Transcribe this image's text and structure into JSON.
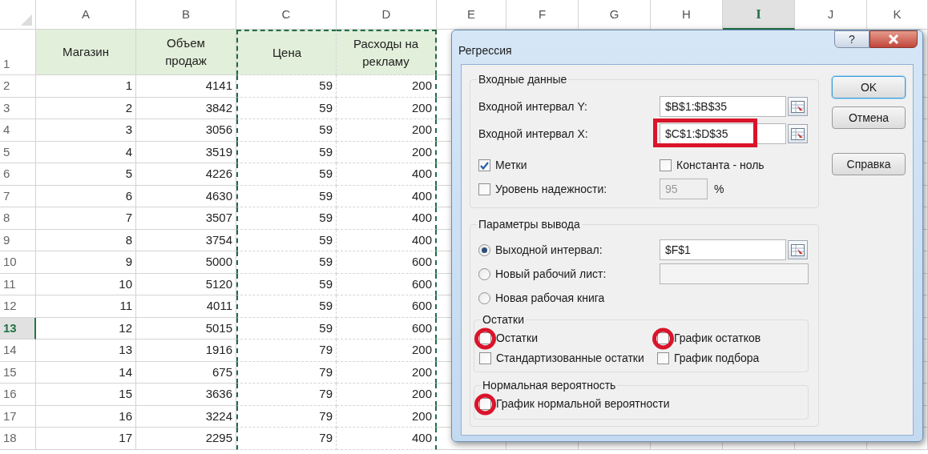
{
  "sheet": {
    "columns": [
      {
        "letter": "A",
        "selected": false,
        "marquee": false
      },
      {
        "letter": "B",
        "selected": false,
        "marquee": false
      },
      {
        "letter": "C",
        "selected": false,
        "marquee": true
      },
      {
        "letter": "D",
        "selected": false,
        "marquee": true
      },
      {
        "letter": "E",
        "selected": false,
        "marquee": false
      },
      {
        "letter": "F",
        "selected": false,
        "marquee": false
      },
      {
        "letter": "G",
        "selected": false,
        "marquee": false
      },
      {
        "letter": "H",
        "selected": false,
        "marquee": false
      },
      {
        "letter": "I",
        "selected": true,
        "marquee": false
      },
      {
        "letter": "J",
        "selected": false,
        "marquee": false
      },
      {
        "letter": "K",
        "selected": false,
        "marquee": false
      }
    ],
    "header_row": {
      "number": "1",
      "selected": false,
      "cells": [
        [
          "Магазин"
        ],
        [
          "Объем",
          "продаж"
        ],
        [
          "Цена"
        ],
        [
          "Расходы на",
          "рекламу"
        ]
      ]
    },
    "rows": [
      {
        "number": "2",
        "selected": false,
        "cells": [
          "1",
          "4141",
          "59",
          "200"
        ]
      },
      {
        "number": "3",
        "selected": false,
        "cells": [
          "2",
          "3842",
          "59",
          "200"
        ]
      },
      {
        "number": "4",
        "selected": false,
        "cells": [
          "3",
          "3056",
          "59",
          "200"
        ]
      },
      {
        "number": "5",
        "selected": false,
        "cells": [
          "4",
          "3519",
          "59",
          "200"
        ]
      },
      {
        "number": "6",
        "selected": false,
        "cells": [
          "5",
          "4226",
          "59",
          "400"
        ]
      },
      {
        "number": "7",
        "selected": false,
        "cells": [
          "6",
          "4630",
          "59",
          "400"
        ]
      },
      {
        "number": "8",
        "selected": false,
        "cells": [
          "7",
          "3507",
          "59",
          "400"
        ]
      },
      {
        "number": "9",
        "selected": false,
        "cells": [
          "8",
          "3754",
          "59",
          "400"
        ]
      },
      {
        "number": "10",
        "selected": false,
        "cells": [
          "9",
          "5000",
          "59",
          "600"
        ]
      },
      {
        "number": "11",
        "selected": false,
        "cells": [
          "10",
          "5120",
          "59",
          "600"
        ]
      },
      {
        "number": "12",
        "selected": false,
        "cells": [
          "11",
          "4011",
          "59",
          "600"
        ]
      },
      {
        "number": "13",
        "selected": true,
        "cells": [
          "12",
          "5015",
          "59",
          "600"
        ]
      },
      {
        "number": "14",
        "selected": false,
        "cells": [
          "13",
          "1916",
          "79",
          "200"
        ]
      },
      {
        "number": "15",
        "selected": false,
        "cells": [
          "14",
          "675",
          "79",
          "200"
        ]
      },
      {
        "number": "16",
        "selected": false,
        "cells": [
          "15",
          "3636",
          "79",
          "200"
        ]
      },
      {
        "number": "17",
        "selected": false,
        "cells": [
          "16",
          "3224",
          "79",
          "200"
        ]
      },
      {
        "number": "18",
        "selected": false,
        "cells": [
          "17",
          "2295",
          "79",
          "400"
        ]
      }
    ]
  },
  "dialog": {
    "title": "Регрессия",
    "help_glyph": "?",
    "input_group": {
      "title": "Входные данные",
      "fields": [
        {
          "label": "Входной интервал Y:",
          "value": "$B$1:$B$35",
          "highlighted": false
        },
        {
          "label": "Входной интервал X:",
          "value": "$C$1:$D$35",
          "highlighted": true
        }
      ],
      "checks": [
        {
          "label": "Метки",
          "checked": true,
          "highlighted": false
        },
        {
          "label": "Константа - ноль",
          "checked": false,
          "highlighted": false
        },
        {
          "label": "Уровень надежности:",
          "checked": false,
          "highlighted": false
        }
      ],
      "confidence": {
        "value": "95",
        "unit": "%",
        "disabled": true
      }
    },
    "output_group": {
      "title": "Параметры вывода",
      "options": [
        {
          "label": "Выходной интервал:",
          "selected": true,
          "field": {
            "value": "$F$1",
            "disabled": false
          }
        },
        {
          "label": "Новый рабочий лист:",
          "selected": false,
          "field": {
            "disabled": true
          }
        },
        {
          "label": "Новая рабочая книга",
          "selected": false
        }
      ],
      "residuals": {
        "title": "Остатки",
        "checks": [
          {
            "label": "Остатки",
            "checked": false,
            "highlighted": true
          },
          {
            "label": "График остатков",
            "checked": false,
            "highlighted": true
          },
          {
            "label": "Стандартизованные остатки",
            "checked": false,
            "highlighted": false
          },
          {
            "label": "График подбора",
            "checked": false,
            "highlighted": false
          }
        ]
      },
      "normal": {
        "title": "Нормальная вероятность",
        "checks": [
          {
            "label": "График нормальной вероятности",
            "checked": false,
            "highlighted": true
          }
        ]
      }
    },
    "buttons": [
      {
        "label": "OK",
        "default": true
      },
      {
        "label": "Отмена",
        "default": false
      },
      {
        "label": "Справка",
        "default": false
      }
    ]
  }
}
